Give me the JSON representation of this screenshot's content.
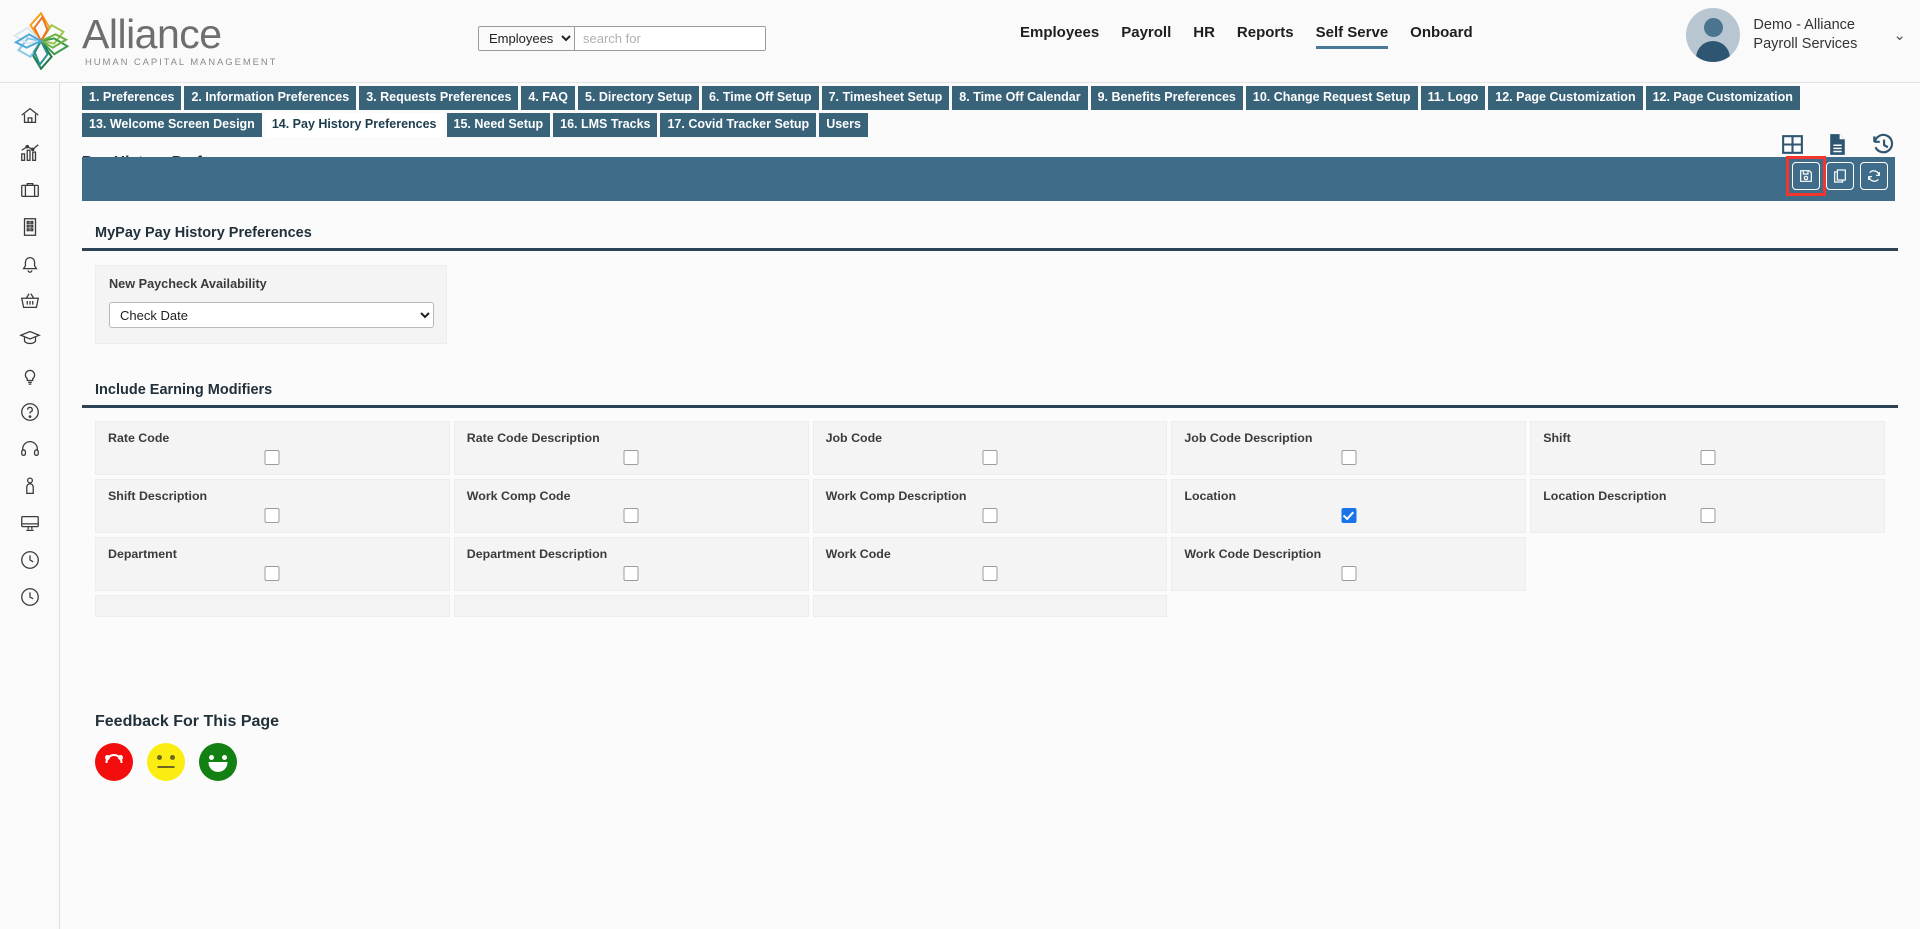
{
  "header": {
    "logo": {
      "title": "Alliance",
      "subtitle": "HUMAN CAPITAL MANAGEMENT"
    },
    "search": {
      "selected": "Employees",
      "options": [
        "Employees"
      ],
      "placeholder": "search for"
    },
    "nav": [
      {
        "label": "Employees",
        "active": false
      },
      {
        "label": "Payroll",
        "active": false
      },
      {
        "label": "HR",
        "active": false
      },
      {
        "label": "Reports",
        "active": false
      },
      {
        "label": "Self Serve",
        "active": true
      },
      {
        "label": "Onboard",
        "active": false
      }
    ],
    "user": {
      "name": "Demo - Alliance Payroll Services",
      "caret": "chevron-down-icon"
    }
  },
  "sidebar": {
    "items": [
      {
        "icon": "home-icon",
        "label": "Home"
      },
      {
        "icon": "analytics-icon",
        "label": "Analytics"
      },
      {
        "icon": "briefcase-icon",
        "label": "Briefcase"
      },
      {
        "icon": "building-icon",
        "label": "Company"
      },
      {
        "icon": "bell-icon",
        "label": "Notifications"
      },
      {
        "icon": "basket-icon",
        "label": "Marketplace"
      },
      {
        "icon": "graduation-cap-icon",
        "label": "Learning"
      },
      {
        "icon": "lightbulb-icon",
        "label": "Ideas"
      },
      {
        "icon": "question-circle-icon",
        "label": "Help"
      },
      {
        "icon": "headset-icon",
        "label": "Support"
      },
      {
        "icon": "person-icon",
        "label": "Profile"
      },
      {
        "icon": "monitor-icon",
        "label": "Desktop"
      },
      {
        "icon": "clock-icon",
        "label": "Time"
      },
      {
        "icon": "clock-history-icon",
        "label": "History"
      }
    ]
  },
  "tabs": {
    "row1": [
      {
        "label": "1. Preferences",
        "active": false
      },
      {
        "label": "2. Information Preferences",
        "active": false
      },
      {
        "label": "3. Requests Preferences",
        "active": false
      },
      {
        "label": "4. FAQ",
        "active": false
      },
      {
        "label": "5. Directory Setup",
        "active": false
      },
      {
        "label": "6. Time Off Setup",
        "active": false
      },
      {
        "label": "7. Timesheet Setup",
        "active": false
      },
      {
        "label": "8. Time Off Calendar",
        "active": false
      },
      {
        "label": "9. Benefits Preferences",
        "active": false
      },
      {
        "label": "10. Change Request Setup",
        "active": false
      },
      {
        "label": "11. Logo",
        "active": false
      },
      {
        "label": "12. Page Customization",
        "active": false
      },
      {
        "label": "12. Page Customization",
        "active": false
      }
    ],
    "row2": [
      {
        "label": "13. Welcome Screen Design",
        "active": false
      },
      {
        "label": "14. Pay History Preferences",
        "active": true
      },
      {
        "label": "15. Need Setup",
        "active": false
      },
      {
        "label": "16. LMS Tracks",
        "active": false
      },
      {
        "label": "17. Covid Tracker Setup",
        "active": false
      },
      {
        "label": "Users",
        "active": false
      }
    ]
  },
  "page": {
    "title": "Pay History Preferences",
    "header_icons": [
      {
        "icon": "grid-table-icon",
        "label": "Table View"
      },
      {
        "icon": "document-icon",
        "label": "Document"
      },
      {
        "icon": "history-restore-icon",
        "label": "History"
      }
    ],
    "toolbar": [
      {
        "icon": "save-floppy-icon",
        "label": "Save",
        "highlighted": true
      },
      {
        "icon": "copy-icon",
        "label": "Copy",
        "highlighted": false
      },
      {
        "icon": "refresh-icon",
        "label": "Refresh",
        "highlighted": false
      }
    ],
    "toolbar_highlight_color": "#f2352e",
    "toolbar_bar_color": "#3f6d89"
  },
  "mypay_section": {
    "title": "MyPay Pay History Preferences",
    "field": {
      "label": "New Paycheck Availability",
      "value": "Check Date",
      "options": [
        "Check Date"
      ]
    }
  },
  "modifiers_section": {
    "title": "Include Earning Modifiers",
    "items": [
      {
        "label": "Rate Code",
        "checked": false
      },
      {
        "label": "Rate Code Description",
        "checked": false
      },
      {
        "label": "Job Code",
        "checked": false
      },
      {
        "label": "Job Code Description",
        "checked": false
      },
      {
        "label": "Shift",
        "checked": false
      },
      {
        "label": "Shift Description",
        "checked": false
      },
      {
        "label": "Work Comp Code",
        "checked": false
      },
      {
        "label": "Work Comp Description",
        "checked": false
      },
      {
        "label": "Location",
        "checked": true
      },
      {
        "label": "Location Description",
        "checked": false
      },
      {
        "label": "Department",
        "checked": false
      },
      {
        "label": "Department Description",
        "checked": false
      },
      {
        "label": "Work Code",
        "checked": false
      },
      {
        "label": "Work Code Description",
        "checked": false
      }
    ],
    "checked_color": "#1a73e8"
  },
  "feedback": {
    "title": "Feedback For This Page",
    "faces": [
      {
        "name": "sad-face-icon",
        "color": "#f40d0d"
      },
      {
        "name": "neutral-face-icon",
        "color": "#fbed12"
      },
      {
        "name": "happy-face-icon",
        "color": "#128012"
      }
    ]
  }
}
